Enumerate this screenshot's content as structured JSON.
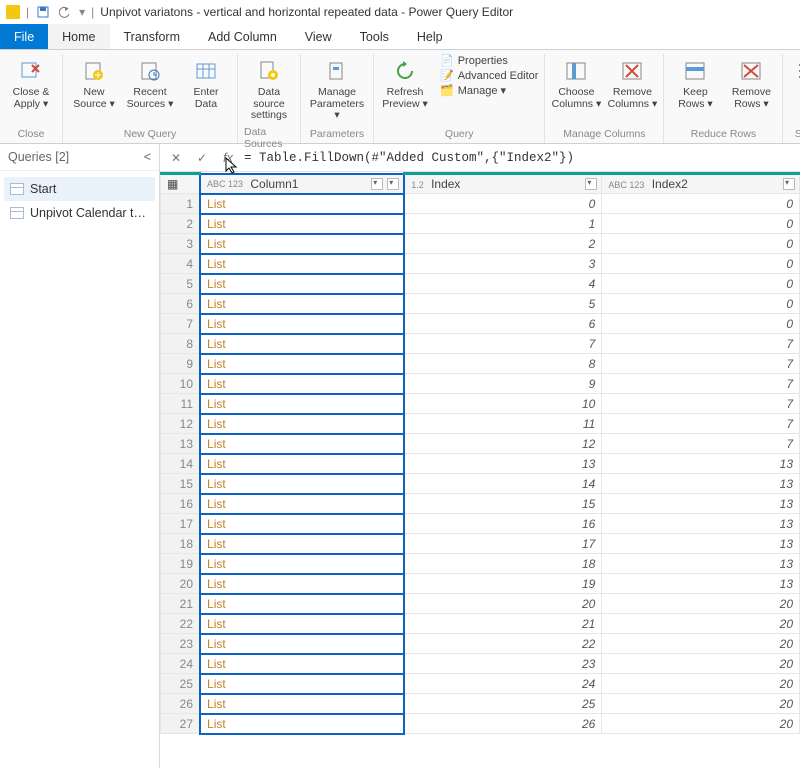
{
  "title": "Unpivot variatons  - vertical and horizontal repeated data - Power Query Editor",
  "menu": {
    "file": "File",
    "home": "Home",
    "transform": "Transform",
    "addcol": "Add Column",
    "view": "View",
    "tools": "Tools",
    "help": "Help"
  },
  "ribbon": {
    "close_apply": "Close &\nApply ▾",
    "new_source": "New\nSource ▾",
    "recent": "Recent\nSources ▾",
    "enter": "Enter\nData",
    "ds_settings": "Data source\nsettings",
    "manage_params": "Manage\nParameters ▾",
    "refresh": "Refresh\nPreview ▾",
    "props": "Properties",
    "adv": "Advanced Editor",
    "manage": "Manage ▾",
    "choose_cols": "Choose\nColumns ▾",
    "remove_cols": "Remove\nColumns ▾",
    "keep_rows": "Keep\nRows ▾",
    "remove_rows": "Remove\nRows ▾",
    "sort": "Sort\nCol",
    "grp_close": "Close",
    "grp_newquery": "New Query",
    "grp_ds": "Data Sources",
    "grp_params": "Parameters",
    "grp_query": "Query",
    "grp_mc": "Manage Columns",
    "grp_rr": "Reduce Rows",
    "grp_sort": "Sort"
  },
  "queries": {
    "header": "Queries [2]",
    "items": [
      {
        "label": "Start"
      },
      {
        "label": "Unpivot Calendar to T..."
      }
    ]
  },
  "formula": "= Table.FillDown(#\"Added Custom\",{\"Index2\"})",
  "columns": {
    "c1": {
      "type": "ABC 123",
      "name": "Column1"
    },
    "c2": {
      "type": "1.2",
      "name": "Index"
    },
    "c3": {
      "type": "ABC 123",
      "name": "Index2"
    }
  },
  "rows": [
    {
      "n": 1,
      "c1": "List",
      "idx": 0,
      "idx2": 0
    },
    {
      "n": 2,
      "c1": "List",
      "idx": 1,
      "idx2": 0
    },
    {
      "n": 3,
      "c1": "List",
      "idx": 2,
      "idx2": 0
    },
    {
      "n": 4,
      "c1": "List",
      "idx": 3,
      "idx2": 0
    },
    {
      "n": 5,
      "c1": "List",
      "idx": 4,
      "idx2": 0
    },
    {
      "n": 6,
      "c1": "List",
      "idx": 5,
      "idx2": 0
    },
    {
      "n": 7,
      "c1": "List",
      "idx": 6,
      "idx2": 0
    },
    {
      "n": 8,
      "c1": "List",
      "idx": 7,
      "idx2": 7
    },
    {
      "n": 9,
      "c1": "List",
      "idx": 8,
      "idx2": 7
    },
    {
      "n": 10,
      "c1": "List",
      "idx": 9,
      "idx2": 7
    },
    {
      "n": 11,
      "c1": "List",
      "idx": 10,
      "idx2": 7
    },
    {
      "n": 12,
      "c1": "List",
      "idx": 11,
      "idx2": 7
    },
    {
      "n": 13,
      "c1": "List",
      "idx": 12,
      "idx2": 7
    },
    {
      "n": 14,
      "c1": "List",
      "idx": 13,
      "idx2": 13
    },
    {
      "n": 15,
      "c1": "List",
      "idx": 14,
      "idx2": 13
    },
    {
      "n": 16,
      "c1": "List",
      "idx": 15,
      "idx2": 13
    },
    {
      "n": 17,
      "c1": "List",
      "idx": 16,
      "idx2": 13
    },
    {
      "n": 18,
      "c1": "List",
      "idx": 17,
      "idx2": 13
    },
    {
      "n": 19,
      "c1": "List",
      "idx": 18,
      "idx2": 13
    },
    {
      "n": 20,
      "c1": "List",
      "idx": 19,
      "idx2": 13
    },
    {
      "n": 21,
      "c1": "List",
      "idx": 20,
      "idx2": 20
    },
    {
      "n": 22,
      "c1": "List",
      "idx": 21,
      "idx2": 20
    },
    {
      "n": 23,
      "c1": "List",
      "idx": 22,
      "idx2": 20
    },
    {
      "n": 24,
      "c1": "List",
      "idx": 23,
      "idx2": 20
    },
    {
      "n": 25,
      "c1": "List",
      "idx": 24,
      "idx2": 20
    },
    {
      "n": 26,
      "c1": "List",
      "idx": 25,
      "idx2": 20
    },
    {
      "n": 27,
      "c1": "List",
      "idx": 26,
      "idx2": 20
    }
  ]
}
